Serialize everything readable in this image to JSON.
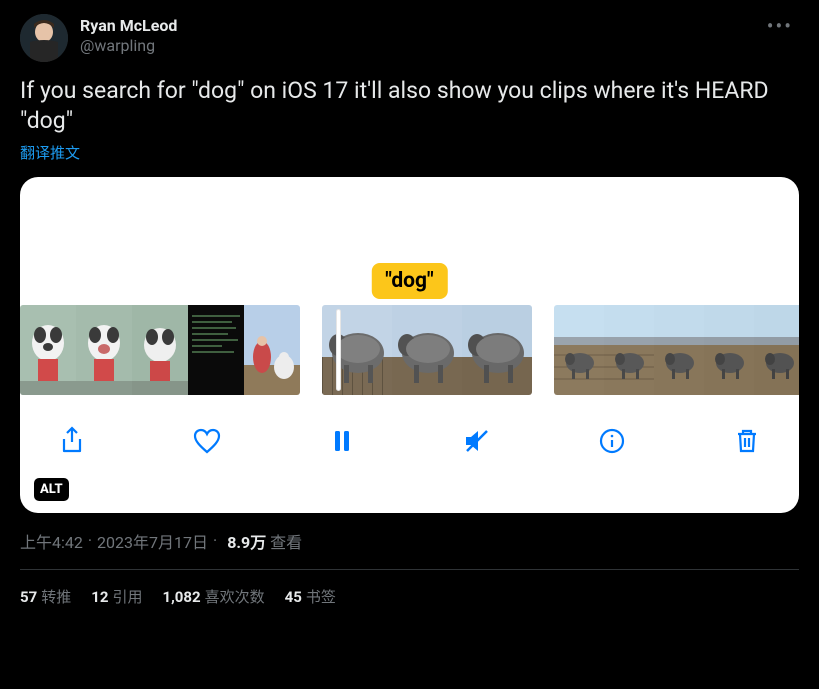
{
  "author": {
    "display_name": "Ryan McLeod",
    "handle": "@warpling"
  },
  "tweet_text": "If you search for \"dog\" on iOS 17 it'll also show you clips where it's HEARD \"dog\"",
  "translate_label": "翻译推文",
  "media": {
    "search_badge": "\"dog\"",
    "alt_badge": "ALT"
  },
  "meta": {
    "time": "上午4:42",
    "date": "2023年7月17日",
    "views_count": "8.9万",
    "views_label": "查看"
  },
  "stats": {
    "retweets": {
      "count": "57",
      "label": "转推"
    },
    "quotes": {
      "count": "12",
      "label": "引用"
    },
    "likes": {
      "count": "1,082",
      "label": "喜欢次数"
    },
    "bookmarks": {
      "count": "45",
      "label": "书签"
    }
  }
}
